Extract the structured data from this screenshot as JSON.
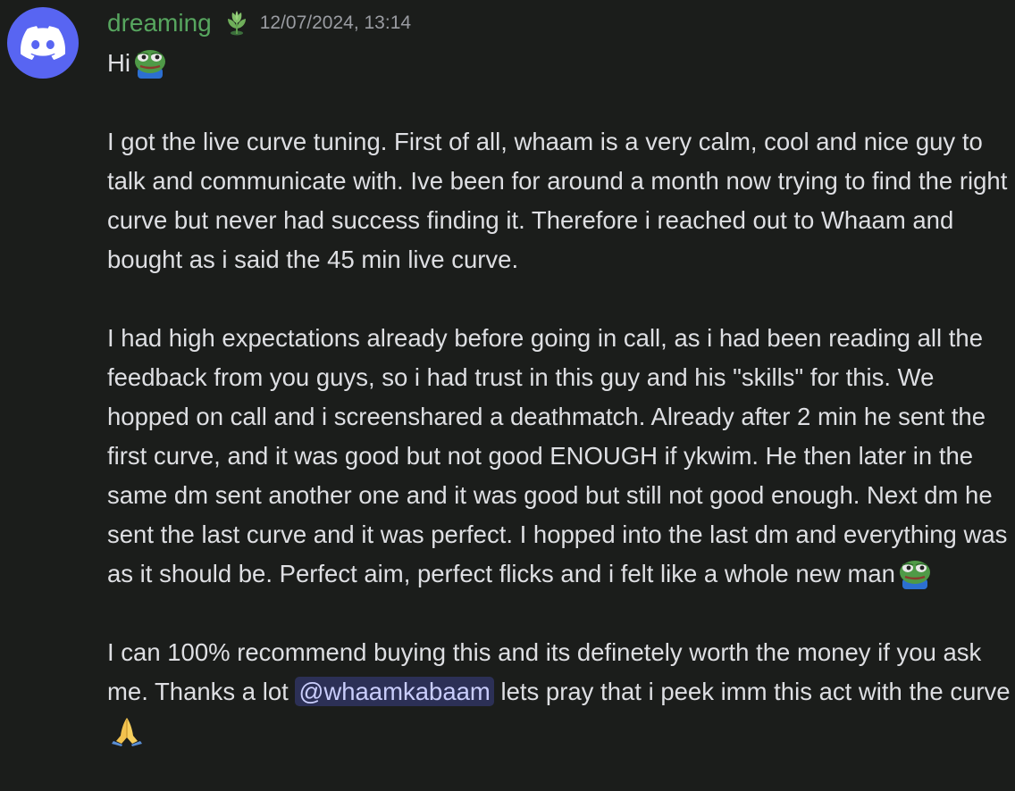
{
  "message": {
    "author": "dreaming",
    "timestamp": "12/07/2024, 13:14",
    "author_color": "#57a65f",
    "avatar_icon": "discord-logo-icon",
    "role_icon": "plant-role-icon",
    "greeting": "Hi",
    "paragraph_1": "I got the live curve tuning. First of all, whaam is a very calm, cool and nice guy to talk and communicate with. Ive been for around a month now trying to find the right curve but never had success finding it. Therefore i reached out to Whaam and bought as i said the 45 min live curve.",
    "paragraph_2": "I had high expectations already before going in call, as i had been reading all the feedback from you guys, so i had trust in this guy and his \"skills\" for this. We hopped on call and i screenshared a deathmatch. Already after 2 min he sent the first curve, and it was good but not good ENOUGH if ykwim. He then later in the same dm sent another one and it was good but still not good enough. Next dm he sent the last curve and it was perfect. I hopped into the last dm and everything was as it should be. Perfect aim, perfect flicks and i felt like a whole new man",
    "paragraph_3_before_mention": "I can 100% recommend buying this and its definetely worth the money if you ask me. Thanks a lot ",
    "mention": "@whaamkabaam",
    "paragraph_3_after_mention": " lets pray that i peek imm this act with the curve",
    "emojis": [
      "pepe-emoji",
      "pepe-emoji",
      "praying-hands-emoji"
    ]
  }
}
